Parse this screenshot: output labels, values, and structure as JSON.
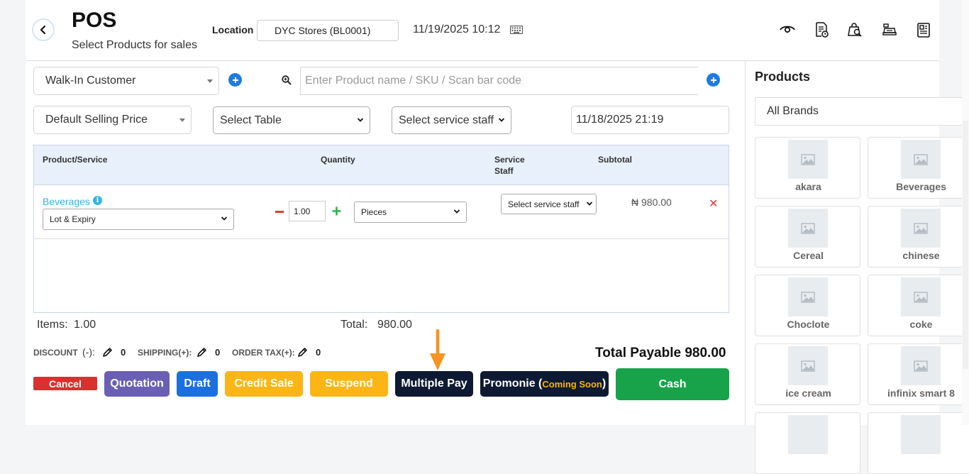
{
  "header": {
    "title": "POS",
    "subtitle": "Select Products for sales",
    "location_label": "Location",
    "location_value": "DYC Stores (BL0001)",
    "datetime": "11/19/2025 10:12"
  },
  "form": {
    "customer": "Walk-In Customer",
    "search_placeholder": "Enter Product name / SKU / Scan bar code",
    "price_group": "Default Selling Price",
    "table_select": "Select Table",
    "service_staff": "Select service staff",
    "transaction_date": "11/18/2025 21:19"
  },
  "table": {
    "headers": {
      "product": "Product/Service",
      "quantity": "Quantity",
      "service_staff_line1": "Service",
      "service_staff_line2": "Staff",
      "subtotal": "Subtotal"
    },
    "rows": [
      {
        "name": "Beverages",
        "lot_expiry": "Lot & Expiry",
        "quantity": "1.00",
        "unit": "Pieces",
        "service_staff": "Select service staff",
        "subtotal": "₦ 980.00"
      }
    ]
  },
  "summary": {
    "items_label": "Items:",
    "items_value": "1.00",
    "total_label": "Total:",
    "total_value": "980.00",
    "discount_label": "DISCOUNT",
    "discount_sign": "(-):",
    "discount_value": "0",
    "shipping_label": "SHIPPING(+):",
    "shipping_value": "0",
    "tax_label": "ORDER TAX(+):",
    "tax_value": "0",
    "total_payable": "Total Payable 980.00"
  },
  "actions": {
    "cancel": "Cancel",
    "quotation": "Quotation",
    "draft": "Draft",
    "credit_sale": "Credit Sale",
    "suspend": "Suspend",
    "multiple_pay": "Multiple Pay",
    "promonie": "Promonie (",
    "coming_soon": "Coming Soon",
    "promonie_close": ")",
    "cash": "Cash"
  },
  "products_panel": {
    "title": "Products",
    "brand": "All Brands",
    "items": [
      "akara",
      "Beverages",
      "Cereal",
      "chinese",
      "Choclote",
      "coke",
      "ice cream",
      "infinix smart 8"
    ]
  },
  "colors": {
    "cancel": "#dc2f2f",
    "quotation": "#6a5fb5",
    "draft": "#1b6fe0",
    "credit_sale": "#fbb514",
    "suspend": "#fbb514",
    "dark": "#0e1a33",
    "cash": "#18a34a",
    "coming_soon": "#ffb300",
    "arrow": "#f7931e"
  }
}
